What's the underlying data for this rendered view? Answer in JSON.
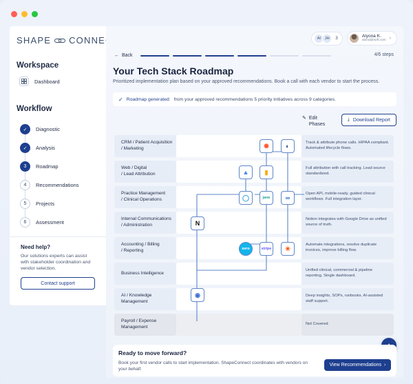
{
  "window": {
    "controls": [
      "#ff5f57",
      "#febc2e",
      "#28c840"
    ]
  },
  "brand": {
    "left": "SHAPE",
    "right": "CONNECT"
  },
  "sidebar": {
    "workspace_title": "Workspace",
    "dashboard_label": "Dashboard",
    "workflow_title": "Workflow",
    "steps": [
      {
        "marker": "✓",
        "label": "Diagnostic",
        "state": "done"
      },
      {
        "marker": "✓",
        "label": "Analysis",
        "state": "done"
      },
      {
        "marker": "3",
        "label": "Roadmap",
        "state": "active"
      },
      {
        "marker": "4",
        "label": "Recommendations",
        "state": "todo"
      },
      {
        "marker": "5",
        "label": "Projects",
        "state": "todo"
      },
      {
        "marker": "6",
        "label": "Assessment",
        "state": "todo"
      }
    ],
    "help": {
      "title": "Need help?",
      "text": "Our solutions experts can assist with stakeholder coordination and vendor selection.",
      "button": "Contact support"
    }
  },
  "header": {
    "avatars": [
      "AI",
      "JH"
    ],
    "avatar_count": "3",
    "user_name": "Alyona K.",
    "user_email": "alona@soft.com"
  },
  "nav": {
    "back": "Back",
    "step_count": "4/6 steps",
    "progress_done": 4,
    "progress_total": 6
  },
  "page": {
    "title": "Your Tech Stack Roadmap",
    "subtitle": "Prioritized implementation plan based on your approved recommendations. Book a call with each vendor to start the process.",
    "banner_label": "Roadmap generated:",
    "banner_text": "from your approved recommendations 5 priority initiatives across 9 categories.",
    "edit_label_1": "Edit",
    "edit_label_2": "Phases",
    "download_label": "Download Report"
  },
  "rows": [
    {
      "cat1": "CRM / Patient Acquisition",
      "cat2": "/ Marketing",
      "desc": "Track & attribute phone calls. HIPAA compliant. Automated lifecycle flows."
    },
    {
      "cat1": "Web / Digital",
      "cat2": "/ Lead Attribution",
      "desc": "Full attribution with call tracking. Lead source standardized."
    },
    {
      "cat1": "Practice Management",
      "cat2": "/ Clinical Operations",
      "desc": "Open API, mobile-ready, guided clinical workflows. Full integration layer."
    },
    {
      "cat1": "Internal Communications",
      "cat2": "/ Administration",
      "desc": "Notion integrates with Google Drive as unified source of truth."
    },
    {
      "cat1": "Accounting / Billing",
      "cat2": "/ Reporting",
      "desc": "Automate integrations, resolve duplicate invoices, improve billing flow."
    },
    {
      "cat1": "Business Intelligence",
      "cat2": "",
      "desc": "Unified clinical, commercial & pipeline reporting. Single dashboard."
    },
    {
      "cat1": "AI / Knowledge",
      "cat2": "Management",
      "desc": "Deep insights, SOPs, runbooks. AI-assisted staff support."
    },
    {
      "cat1": "Payroll / Expense",
      "cat2": "Management",
      "desc": "Not Covered"
    }
  ],
  "logos": [
    {
      "name": "hubspot-logo",
      "glyph": "✺",
      "color": "#ff5c35"
    },
    {
      "name": "callrail-logo",
      "glyph": "◐",
      "color": "#1e3f8f"
    },
    {
      "name": "google-ads-logo",
      "glyph": "▲",
      "color": "#4285f4"
    },
    {
      "name": "analytics-logo",
      "glyph": "▮",
      "color": "#f9ab00"
    },
    {
      "name": "practice-logo-1",
      "glyph": "◯",
      "color": "#2f9fd8"
    },
    {
      "name": "jane-logo",
      "glyph": "jane",
      "color": "#1aa59a"
    },
    {
      "name": "practice-logo-2",
      "glyph": "∞",
      "color": "#1a6fd1"
    },
    {
      "name": "notion-logo",
      "glyph": "N",
      "color": "#111111"
    },
    {
      "name": "xero-logo",
      "glyph": "xero",
      "color": "#13b5ea"
    },
    {
      "name": "stripe-logo",
      "glyph": "stripe",
      "color": "#635bff"
    },
    {
      "name": "zapier-logo",
      "glyph": "✳",
      "color": "#ff4a00"
    },
    {
      "name": "ai-logo",
      "glyph": "◉",
      "color": "#3d6fd1"
    }
  ],
  "cta": {
    "title": "Ready to move forward?",
    "text": "Book your first vendor calls to start implementation. ShapeConnect coordinates with vendors on your behalf.",
    "button": "View Recommendations"
  },
  "colors": {
    "accent": "#1e3f8f",
    "line": "#5e86c8"
  }
}
